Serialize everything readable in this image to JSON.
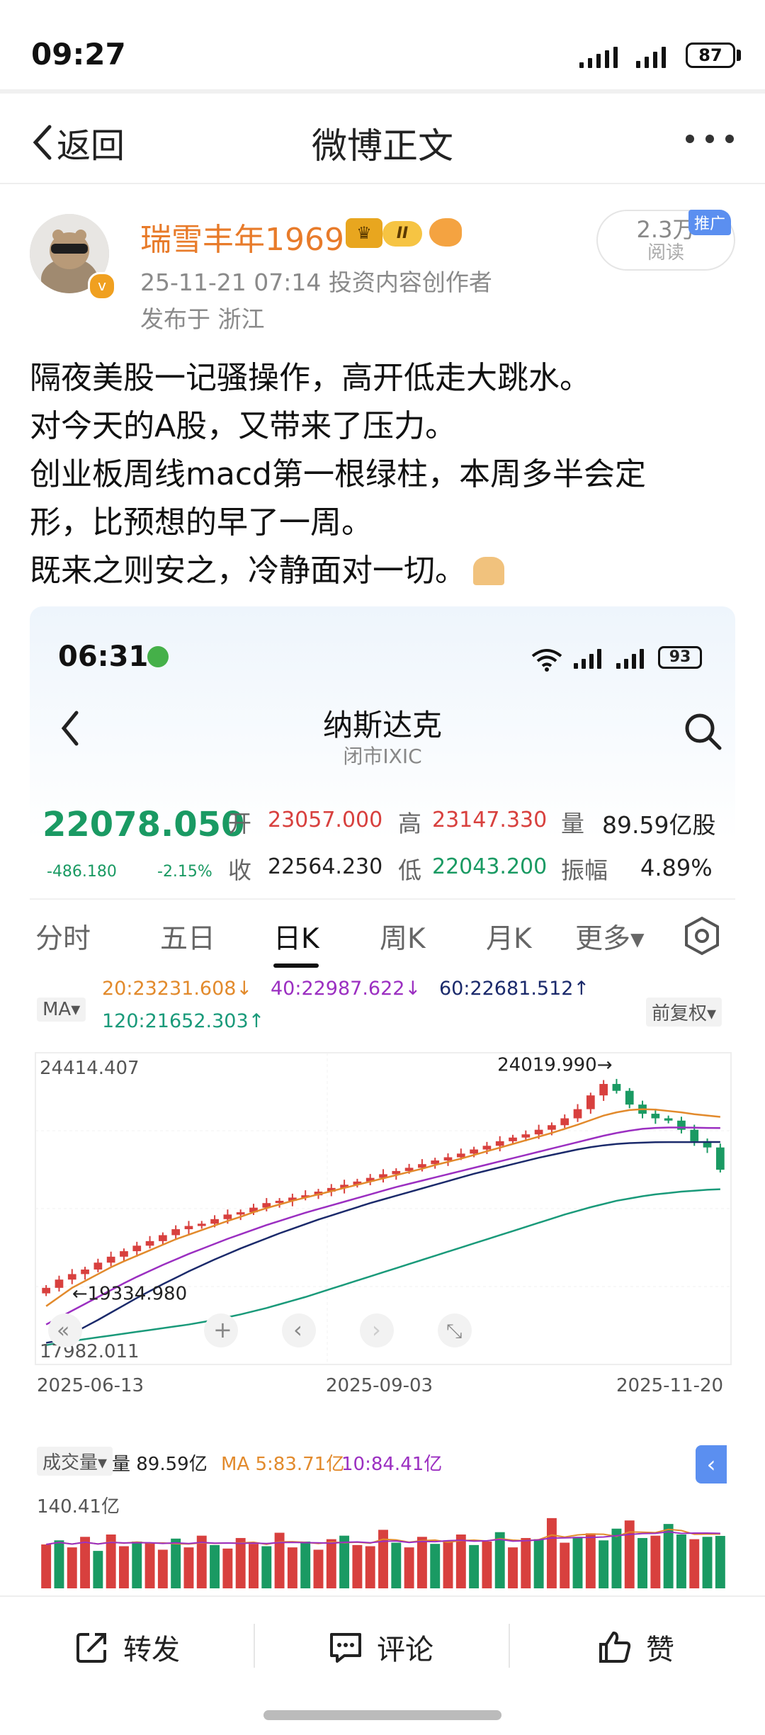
{
  "status_bar": {
    "time": "09:27",
    "battery": "87"
  },
  "nav": {
    "back_label": "返回",
    "title": "微博正文"
  },
  "post": {
    "username": "瑞雪丰年1969",
    "level_badge": "II",
    "verified_mark": "v",
    "meta": "25-11-21 07:14  投资内容创作者",
    "location": "发布于 浙江",
    "reads_count": "2.3万",
    "reads_label": "阅读",
    "promo_tag": "推广",
    "body_lines": [
      "隔夜美股一记骚操作，高开低走大跳水。",
      "对今天的A股，又带来了压力。",
      "创业板周线macd第一根绿柱，本周多半会定",
      "形，比预想的早了一周。",
      "既来之则安之，冷静面对一切。"
    ]
  },
  "embedded": {
    "status_time": "06:31",
    "battery": "93",
    "title": "纳斯达克",
    "subtitle": "闭市IXIC",
    "price": "22078.050",
    "change": "-486.180",
    "change_pct": "-2.15%",
    "quote": {
      "open_label": "开",
      "open": "23057.000",
      "high_label": "高",
      "high": "23147.330",
      "volume_label": "量",
      "volume": "89.59亿股",
      "close_label": "收",
      "close": "22564.230",
      "low_label": "低",
      "low": "22043.200",
      "amplitude_label": "振幅",
      "amplitude": "4.89%"
    },
    "tabs": [
      "分时",
      "五日",
      "日K",
      "周K",
      "月K",
      "更多▾"
    ],
    "active_tab": 2,
    "ma_selector": "MA▾",
    "ma_legend": {
      "ma20": "20:23231.608↓",
      "ma40": "40:22987.622↓",
      "ma60": "60:22681.512↑",
      "ma120": "120:21652.303↑"
    },
    "adjust_selector": "前复权▾",
    "volume_selector": "成交量▾",
    "volume_legend": {
      "vol": "量 89.59亿",
      "ma5": "MA 5:83.71亿",
      "ma10": "10:84.41亿"
    },
    "chart_controls": [
      "«",
      "+",
      "‹",
      "›",
      "⤡"
    ],
    "colors": {
      "up": "#d8403e",
      "down": "#1a9a63",
      "ma20": "#e28a2c",
      "ma40": "#9b2fc1",
      "ma60": "#1b2a6b",
      "ma120": "#1a9a7a"
    }
  },
  "chart_data": [
    {
      "type": "line",
      "x_start": "2025-06-13",
      "x_end": "2025-11-20",
      "xticks": [
        "2025-06-13",
        "2025-09-03",
        "2025-11-20"
      ],
      "ylim": [
        17982.011,
        24414.407
      ],
      "y_top_label": "24414.407",
      "y_bottom_label": "17982.011",
      "annotations": [
        {
          "label": "24019.990→",
          "value": 24019.99
        },
        {
          "label": "←19334.980",
          "value": 19334.98
        }
      ],
      "close_series": [
        19500,
        19680,
        19800,
        19900,
        20050,
        20180,
        20300,
        20420,
        20520,
        20650,
        20780,
        20850,
        20900,
        21000,
        21100,
        21150,
        21250,
        21350,
        21400,
        21470,
        21520,
        21600,
        21680,
        21750,
        21820,
        21900,
        21980,
        22050,
        22120,
        22200,
        22280,
        22350,
        22430,
        22520,
        22600,
        22700,
        22780,
        22850,
        22950,
        23050,
        23200,
        23400,
        23700,
        23950,
        23800,
        23500,
        23300,
        23200,
        23150,
        22950,
        22700,
        22564,
        22078
      ],
      "series": [
        {
          "name": "20",
          "values": [
            19100,
            19300,
            19500,
            19650,
            19800,
            19950,
            20080,
            20200,
            20320,
            20440,
            20560,
            20660,
            20760,
            20860,
            20960,
            21050,
            21150,
            21240,
            21320,
            21400,
            21470,
            21540,
            21610,
            21680,
            21750,
            21820,
            21890,
            21960,
            22030,
            22100,
            22180,
            22250,
            22320,
            22400,
            22480,
            22560,
            22640,
            22720,
            22800,
            22880,
            22970,
            23060,
            23160,
            23260,
            23330,
            23380,
            23400,
            23390,
            23360,
            23330,
            23290,
            23260,
            23232
          ]
        },
        {
          "name": "40",
          "values": [
            18700,
            18850,
            19000,
            19150,
            19300,
            19450,
            19600,
            19740,
            19870,
            20000,
            20120,
            20240,
            20350,
            20460,
            20570,
            20670,
            20770,
            20870,
            20960,
            21050,
            21140,
            21220,
            21300,
            21380,
            21460,
            21540,
            21620,
            21700,
            21770,
            21840,
            21910,
            21980,
            22050,
            22120,
            22190,
            22260,
            22330,
            22400,
            22470,
            22540,
            22610,
            22680,
            22750,
            22820,
            22880,
            22930,
            22970,
            22990,
            23000,
            23000,
            22995,
            22990,
            22988
          ]
        },
        {
          "name": "60",
          "values": [
            18300,
            18350,
            18500,
            18650,
            18800,
            18960,
            19120,
            19280,
            19430,
            19580,
            19720,
            19860,
            19990,
            20120,
            20240,
            20360,
            20470,
            20580,
            20690,
            20790,
            20890,
            20990,
            21080,
            21170,
            21260,
            21350,
            21430,
            21510,
            21590,
            21670,
            21750,
            21830,
            21910,
            21990,
            22060,
            22130,
            22200,
            22270,
            22340,
            22400,
            22460,
            22520,
            22570,
            22610,
            22640,
            22660,
            22670,
            22678,
            22680,
            22681,
            22681,
            22682,
            22682
          ]
        },
        {
          "name": "120",
          "values": [
            18250,
            18300,
            18340,
            18380,
            18420,
            18460,
            18500,
            18540,
            18580,
            18620,
            18660,
            18700,
            18750,
            18800,
            18860,
            18920,
            18990,
            19060,
            19140,
            19220,
            19300,
            19390,
            19480,
            19570,
            19660,
            19750,
            19840,
            19930,
            20020,
            20110,
            20200,
            20290,
            20380,
            20470,
            20560,
            20650,
            20740,
            20830,
            20920,
            21010,
            21100,
            21180,
            21260,
            21330,
            21400,
            21450,
            21500,
            21540,
            21570,
            21600,
            21620,
            21640,
            21652
          ]
        }
      ]
    },
    {
      "type": "bar",
      "ylabel_top": "140.41亿",
      "ylim": [
        0,
        140.41
      ],
      "values": [
        75,
        82,
        70,
        88,
        64,
        92,
        72,
        80,
        78,
        66,
        85,
        70,
        90,
        74,
        68,
        86,
        76,
        72,
        95,
        70,
        80,
        66,
        84,
        90,
        74,
        72,
        100,
        78,
        70,
        88,
        76,
        82,
        92,
        74,
        80,
        96,
        70,
        86,
        84,
        120,
        78,
        88,
        94,
        82,
        102,
        116,
        86,
        90,
        110,
        92,
        84,
        88,
        89.59
      ],
      "up_days": [
        1,
        0,
        1,
        1,
        0,
        1,
        1,
        0,
        1,
        1,
        0,
        1,
        1,
        0,
        1,
        1,
        1,
        0,
        1,
        1,
        0,
        1,
        1,
        0,
        1,
        1,
        1,
        0,
        1,
        1,
        0,
        1,
        1,
        0,
        1,
        0,
        1,
        1,
        0,
        1,
        1,
        0,
        1,
        0,
        0,
        1,
        0,
        1,
        0,
        0,
        1,
        0,
        0
      ]
    }
  ],
  "actions": {
    "repost": "转发",
    "comment": "评论",
    "like": "赞"
  }
}
